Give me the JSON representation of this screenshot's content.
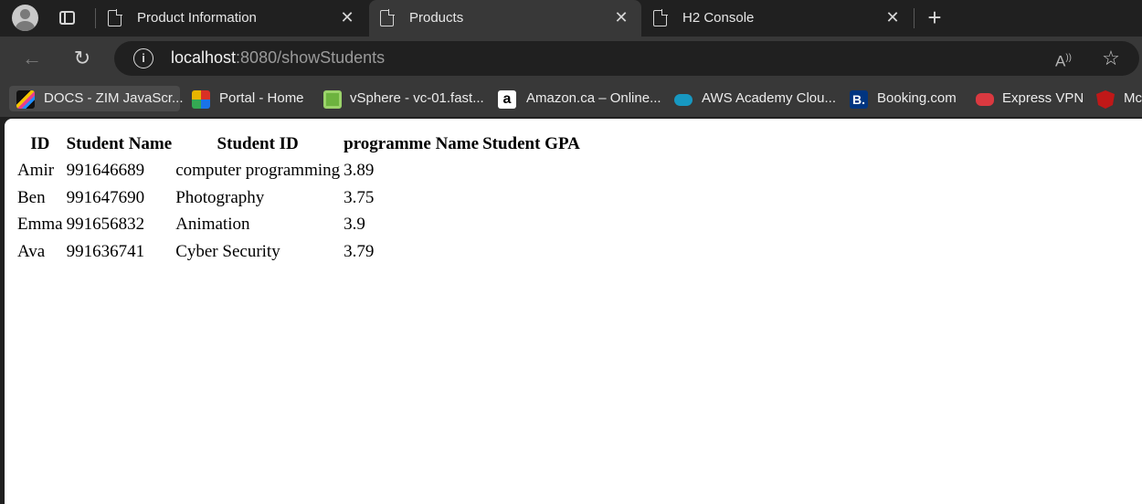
{
  "browser": {
    "tabs": [
      {
        "title": "Product Information",
        "active": false
      },
      {
        "title": "Products",
        "active": true
      },
      {
        "title": "H2 Console",
        "active": false
      }
    ],
    "address": {
      "host": "localhost",
      "path": ":8080/showStudents"
    },
    "bookmarks": [
      {
        "label": "DOCS - ZIM JavaScr...",
        "icon": "zim-icon"
      },
      {
        "label": "Portal - Home",
        "icon": "portal-icon"
      },
      {
        "label": "vSphere - vc-01.fast...",
        "icon": "vsphere-icon"
      },
      {
        "label": "Amazon.ca – Online...",
        "icon": "amazon-icon"
      },
      {
        "label": "AWS Academy Clou...",
        "icon": "cloud-icon"
      },
      {
        "label": "Booking.com",
        "icon": "booking-icon"
      },
      {
        "label": "Express VPN",
        "icon": "expressvpn-icon"
      },
      {
        "label": "Mc",
        "icon": "mcafee-icon"
      }
    ]
  },
  "table": {
    "headers": [
      "ID",
      "Student Name",
      "Student ID",
      "programme Name",
      "Student GPA"
    ],
    "rows": [
      [
        "Amir",
        "991646689",
        "computer programming",
        "3.89"
      ],
      [
        "Ben",
        "991647690",
        "Photography",
        "3.75"
      ],
      [
        "Emma",
        "991656832",
        "Animation",
        "3.9"
      ],
      [
        "Ava",
        "991636741",
        "Cyber Security",
        "3.79"
      ]
    ]
  }
}
